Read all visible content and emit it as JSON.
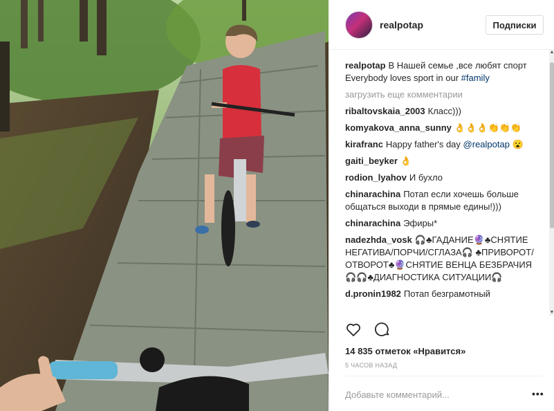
{
  "post": {
    "username": "realpotap",
    "follow_button": "Подписки",
    "caption": {
      "user": "realpotap",
      "text": "В Нашей семье ,все любят спорт Everybody loves sport in our",
      "hashtag": "#family"
    },
    "load_more": "загрузить еще комментарии",
    "comments": [
      {
        "user": "ribaltovskaia_2003",
        "text": "Класс)))"
      },
      {
        "user": "komyakova_anna_sunny",
        "text": "👌👌👌👏👏👏"
      },
      {
        "user": "kirafranc",
        "text": "Happy father's day",
        "mention": "@realpotap",
        "emoji": "😮"
      },
      {
        "user": "gaiti_beyker",
        "text": "👌"
      },
      {
        "user": "rodion_lyahov",
        "text": "И бухло"
      },
      {
        "user": "chinarachina",
        "text": "Потап если хочешь больше общаться выходи в прямые едины!)))"
      },
      {
        "user": "chinarachina",
        "text": "Эфиры*"
      },
      {
        "user": "nadezhda_vosk",
        "text": "🎧♣ГАДАНИЕ🔮♣СНЯТИЕ НЕГАТИВА/ПОРЧИ/СГЛАЗА🎧 ♣ПРИВОРОТ/ ОТВОРОТ♣🔮СНЯТИЕ ВЕНЦА БЕЗБРАЧИЯ🎧🎧♣ДИАГНОСТИКА СИТУАЦИИ🎧"
      },
      {
        "user": "d.pronin1982",
        "text": "Потап безграмотный"
      }
    ],
    "likes": "14 835 отметок «Нравится»",
    "time": "5 ЧАСОВ НАЗАД",
    "add_comment_placeholder": "Добавьте комментарий...",
    "more_options": "•••",
    "icons": [
      "heart-icon",
      "comment-icon"
    ]
  }
}
